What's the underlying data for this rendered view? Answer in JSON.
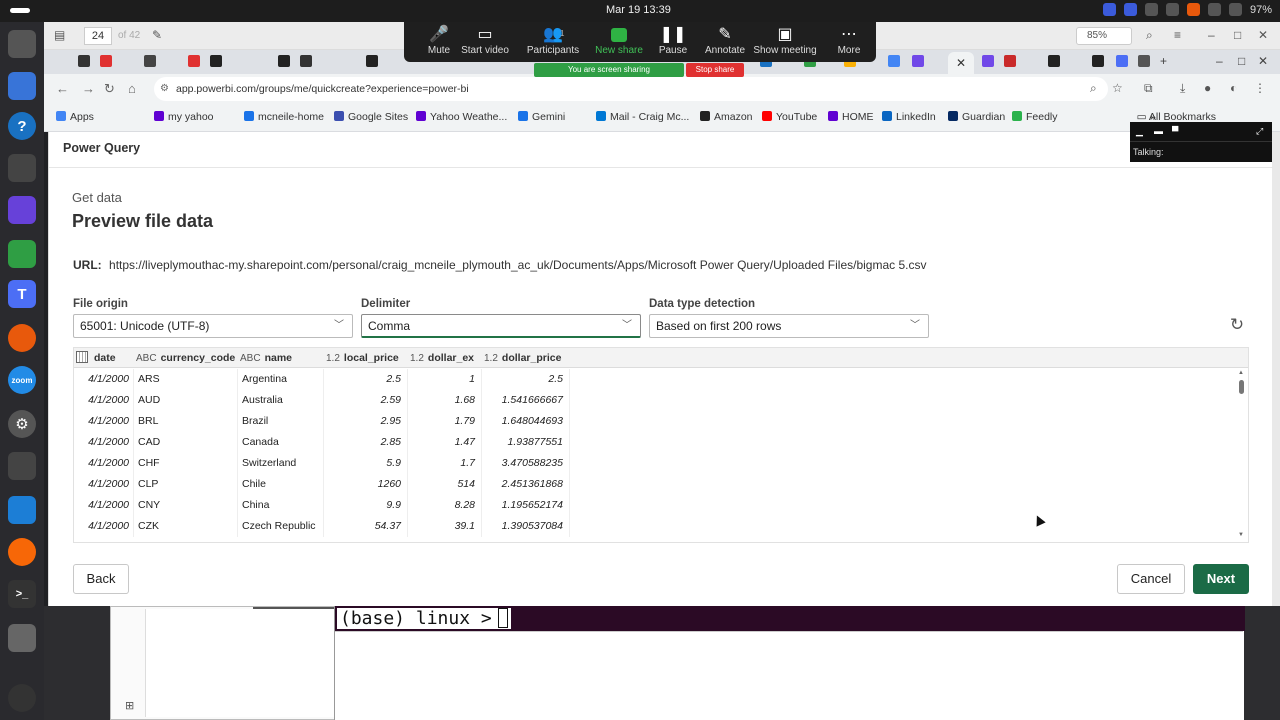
{
  "os": {
    "clock": "Mar 19  13:39",
    "battery": "97%"
  },
  "pdf_toolbar": {
    "page": "24",
    "page_of": "of 42",
    "zoom": "85%"
  },
  "zoom_meeting": {
    "items": [
      {
        "label": "Mute",
        "icon": "microphone-icon",
        "glyph": "🎤"
      },
      {
        "label": "Start video",
        "icon": "video-off-icon",
        "glyph": "▭"
      },
      {
        "label": "Participants",
        "icon": "participants-icon",
        "glyph": "👥"
      },
      {
        "label": "New share",
        "icon": "share-icon",
        "glyph": ""
      },
      {
        "label": "Pause",
        "icon": "pause-icon",
        "glyph": "❚❚"
      },
      {
        "label": "Annotate",
        "icon": "pencil-icon",
        "glyph": "✎"
      },
      {
        "label": "Show meeting",
        "icon": "monitor-icon",
        "glyph": "▣"
      },
      {
        "label": "More",
        "icon": "more-icon",
        "glyph": "⋯"
      }
    ],
    "participants_count": "1",
    "sharing_banner": "You are screen sharing",
    "stop_share": "Stop share",
    "talking_label": "Talking:"
  },
  "browser": {
    "url": "app.powerbi.com/groups/me/quickcreate?experience=power-bi",
    "bookmarks": [
      {
        "label": "Apps",
        "color": "#4285f4"
      },
      {
        "label": "my yahoo",
        "color": "#6001d2"
      },
      {
        "label": "mcneile-home",
        "color": "#1a73e8"
      },
      {
        "label": "Google Sites",
        "color": "#3c4fb0"
      },
      {
        "label": "Yahoo Weathe...",
        "color": "#6001d2"
      },
      {
        "label": "Gemini",
        "color": "#1a73e8"
      },
      {
        "label": "Mail - Craig Mc...",
        "color": "#0078d4"
      },
      {
        "label": "Amazon",
        "color": "#222"
      },
      {
        "label": "YouTube",
        "color": "#ff0000"
      },
      {
        "label": "HOME",
        "color": "#6001d2"
      },
      {
        "label": "LinkedIn",
        "color": "#0a66c2"
      },
      {
        "label": "Guardian",
        "color": "#052962"
      },
      {
        "label": "Feedly",
        "color": "#2bb24c"
      }
    ],
    "all_bookmarks": "All Bookmarks"
  },
  "power_query": {
    "app_title": "Power Query",
    "section_sup": "Get data",
    "section_title": "Preview file data",
    "url_label": "URL:",
    "url_value": "https://liveplymouthac-my.sharepoint.com/personal/craig_mcneile_plymouth_ac_uk/Documents/Apps/Microsoft Power Query/Uploaded Files/bigmac 5.csv",
    "file_origin_label": "File origin",
    "file_origin_value": "65001: Unicode (UTF-8)",
    "delimiter_label": "Delimiter",
    "delimiter_value": "Comma",
    "detection_label": "Data type detection",
    "detection_value": "Based on first 200 rows",
    "columns": [
      {
        "name": "date",
        "type": ""
      },
      {
        "name": "currency_code",
        "type": "ABC"
      },
      {
        "name": "name",
        "type": "ABC"
      },
      {
        "name": "local_price",
        "type": "1.2"
      },
      {
        "name": "dollar_ex",
        "type": "1.2"
      },
      {
        "name": "dollar_price",
        "type": "1.2"
      }
    ],
    "rows": [
      [
        "4/1/2000",
        "ARS",
        "Argentina",
        "2.5",
        "1",
        "2.5"
      ],
      [
        "4/1/2000",
        "AUD",
        "Australia",
        "2.59",
        "1.68",
        "1.541666667"
      ],
      [
        "4/1/2000",
        "BRL",
        "Brazil",
        "2.95",
        "1.79",
        "1.648044693"
      ],
      [
        "4/1/2000",
        "CAD",
        "Canada",
        "2.85",
        "1.47",
        "1.93877551"
      ],
      [
        "4/1/2000",
        "CHF",
        "Switzerland",
        "5.9",
        "1.7",
        "3.470588235"
      ],
      [
        "4/1/2000",
        "CLP",
        "Chile",
        "1260",
        "514",
        "2.451361868"
      ],
      [
        "4/1/2000",
        "CNY",
        "China",
        "9.9",
        "8.28",
        "1.195652174"
      ],
      [
        "4/1/2000",
        "CZK",
        "Czech Republic",
        "54.37",
        "39.1",
        "1.390537084"
      ]
    ],
    "back_label": "Back",
    "cancel_label": "Cancel",
    "next_label": "Next"
  },
  "terminal": {
    "prompt": "(base) linux >"
  }
}
